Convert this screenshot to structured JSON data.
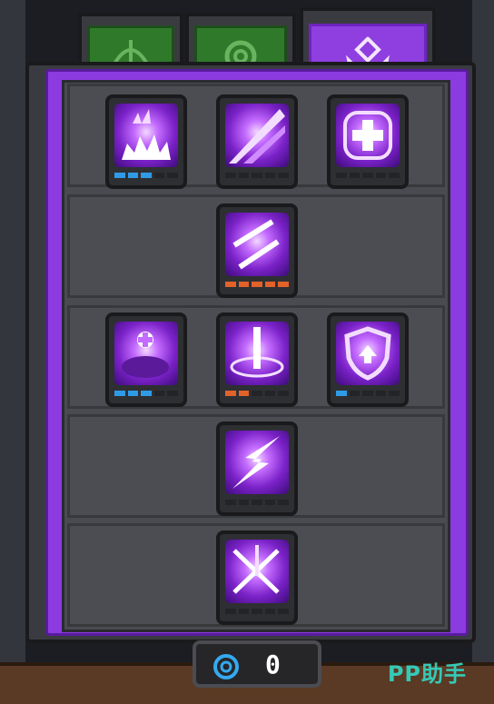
{
  "tabs": [
    {
      "name": "bow-tab",
      "icon": "bow-icon",
      "active": false
    },
    {
      "name": "spiral-tab",
      "icon": "spiral-icon",
      "active": false
    },
    {
      "name": "purple-emblem-tab",
      "icon": "emblem-icon",
      "active": true
    }
  ],
  "skills": [
    {
      "icon": "explosion-icon",
      "level": 3,
      "max": 5,
      "bar_color": "blue"
    },
    {
      "icon": "slash-icon",
      "level": 0,
      "max": 5,
      "bar_color": "blue"
    },
    {
      "icon": "heal-cross-icon",
      "level": 0,
      "max": 5,
      "bar_color": "blue"
    },
    {
      "icon": "swords-icon",
      "level": 5,
      "max": 5,
      "bar_color": "orange"
    },
    {
      "icon": "pet-heal-icon",
      "level": 3,
      "max": 5,
      "bar_color": "blue"
    },
    {
      "icon": "sword-pillar-icon",
      "level": 2,
      "max": 5,
      "bar_color": "orange"
    },
    {
      "icon": "shield-up-icon",
      "level": 1,
      "max": 5,
      "bar_color": "blue"
    },
    {
      "icon": "lightning-icon",
      "level": 0,
      "max": 5,
      "bar_color": "blue"
    },
    {
      "icon": "sword-rain-icon",
      "level": 0,
      "max": 5,
      "bar_color": "blue"
    }
  ],
  "currency": {
    "icon": "blue-swirl-gem-icon",
    "amount": "0"
  },
  "watermark": "PP助手",
  "colors": {
    "accent": "#8b3be0",
    "tab_green": "#2f7a2a",
    "bar_blue": "#2f9be6",
    "bar_orange": "#e2622a"
  }
}
